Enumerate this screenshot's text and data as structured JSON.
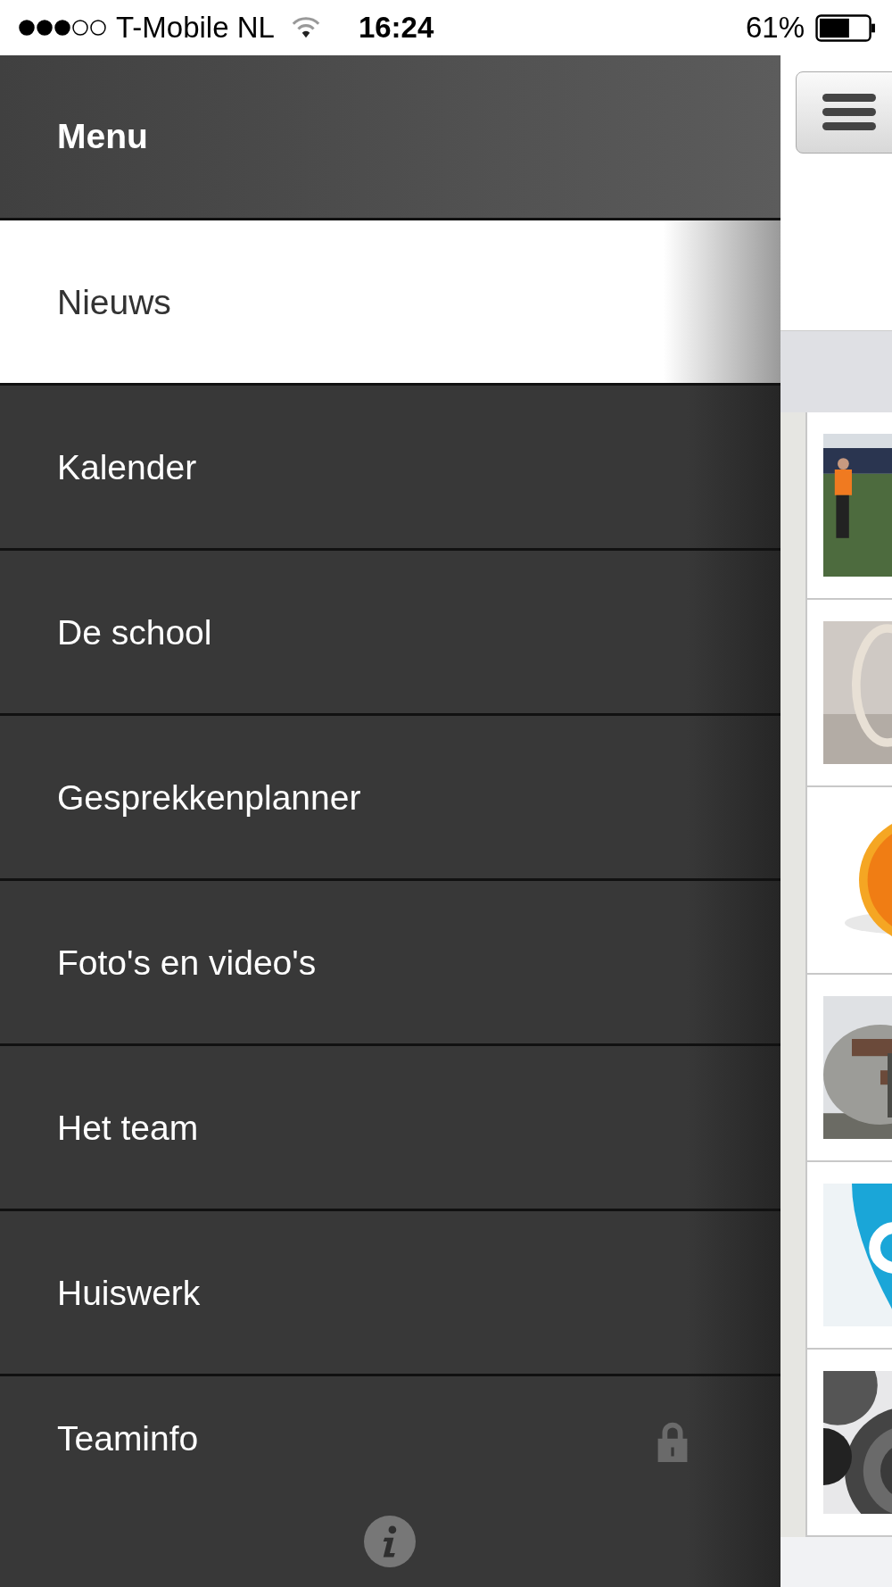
{
  "status_bar": {
    "carrier": "T-Mobile NL",
    "time": "16:24",
    "battery": "61%"
  },
  "menu": {
    "title": "Menu",
    "items": [
      {
        "label": "Nieuws",
        "selected": true,
        "locked": false
      },
      {
        "label": "Kalender",
        "selected": false,
        "locked": false
      },
      {
        "label": "De school",
        "selected": false,
        "locked": false
      },
      {
        "label": "Gesprekkenplanner",
        "selected": false,
        "locked": false
      },
      {
        "label": "Foto's en video's",
        "selected": false,
        "locked": false
      },
      {
        "label": "Het team",
        "selected": false,
        "locked": false
      },
      {
        "label": "Huiswerk",
        "selected": false,
        "locked": false
      },
      {
        "label": "Teaminfo",
        "selected": false,
        "locked": true
      }
    ]
  }
}
